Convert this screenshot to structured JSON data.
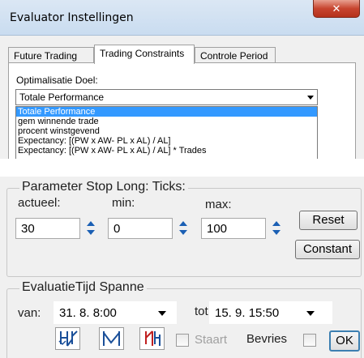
{
  "window": {
    "title": "Evaluator Instellingen"
  },
  "tabs": [
    {
      "label": "Future Trading"
    },
    {
      "label": "Trading Constraints"
    },
    {
      "label": "Controle Period"
    }
  ],
  "optimization": {
    "label": "Optimalisatie Doel:",
    "selected": "Totale Performance",
    "options": [
      "Totale Performance",
      "gem winnende trade",
      "procent winstgevend",
      "Expectancy: [(PW x AW- PL x AL) / AL]",
      "Expectancy: [(PW x AW- PL x AL) / AL] * Trades"
    ]
  },
  "stop_group": {
    "title": "Parameter Stop Long: Ticks:",
    "actual_label": "actueel:",
    "min_label": "min:",
    "max_label": "max:",
    "actual_value": "30",
    "min_value": "0",
    "max_value": "100",
    "reset_label": "Reset",
    "constant_label": "Constant"
  },
  "time_group": {
    "title": "EvaluatieTijd Spanne",
    "from_label": "van:",
    "from_value": "31. 8.  8:00",
    "to_label": "tot:",
    "to_value": "15. 9. 15:50",
    "tail_label": "Staart",
    "freeze_label": "Bevries",
    "ok_label": "OK"
  },
  "colors": {
    "accent": "#1a5fb4",
    "selection": "#3399ff",
    "close_button": "#c7452f"
  }
}
